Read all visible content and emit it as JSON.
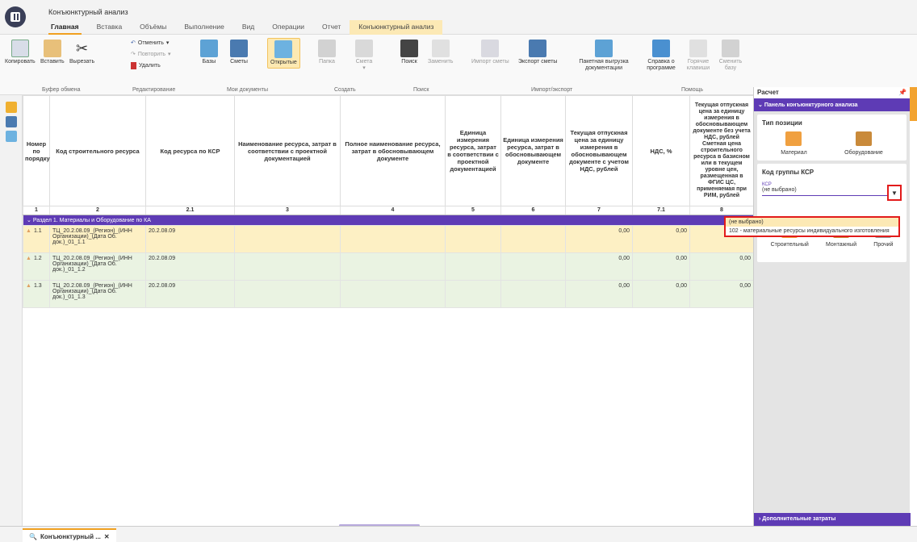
{
  "app": {
    "title": "Конъюнктурный анализ"
  },
  "tabs": [
    "Главная",
    "Вставка",
    "Объёмы",
    "Выполнение",
    "Вид",
    "Операции",
    "Отчет",
    "Конъюнктурный анализ"
  ],
  "ribbon": {
    "copy": "Копировать",
    "paste": "Вставить",
    "cut": "Вырезать",
    "clipboard_group": "Буфер обмена",
    "undo": "Отменить",
    "redo": "Повторить",
    "delete": "Удалить",
    "edit_group": "Редактирование",
    "bases": "Базы",
    "estimates": "Сметы",
    "opened": "Открытые",
    "mydocs_group": "Мои документы",
    "folder": "Папка",
    "estimate": "Смета",
    "create_group": "Создать",
    "search": "Поиск",
    "replace": "Заменить",
    "search_group": "Поиск",
    "import": "Импорт сметы",
    "export": "Экспорт сметы",
    "batch": "Пакетная выгрузка документации",
    "io_group": "Импорт/экспорт",
    "about": "Справка о программе",
    "hotkeys": "Горячие клавиши",
    "changebase": "Сменить базу",
    "help_group": "Помощь"
  },
  "grid": {
    "headers": [
      "Номер по порядку",
      "Код строительного ресурса",
      "Код ресурса по КСР",
      "Наименование ресурса, затрат в соответствии с проектной документацией",
      "Полное наименование ресурса, затрат в обосновывающем документе",
      "Единица измерения ресурса, затрат в соответствии с проектной документацией",
      "Единица измерения ресурса, затрат в обосновывающем документе",
      "Текущая отпускная цена за единицу измерения в обосновывающем документе с учетом НДС, рублей",
      "НДС, %",
      "Текущая отпускная цена за единицу измерения в обосновывающем документе без учета НДС, рублей Сметная цена строительного ресурса в базисном или в текущем уровне цен, размещенная в ФГИС ЦС, применяемая при РИМ, рублей"
    ],
    "numbers": [
      "1",
      "2",
      "2.1",
      "3",
      "4",
      "5",
      "6",
      "7",
      "7.1",
      "8"
    ],
    "section": "Раздел 1. Материалы и Оборудование по КА",
    "rows": [
      {
        "n": "1.1",
        "code": "ТЦ_20.2.08.09_(Регион)_(ИНН Организации)_(Дата Об. док.)_01_1.1",
        "ksr": "20.2.08.09",
        "price": "0,00",
        "vat": "0,00",
        "p8": ""
      },
      {
        "n": "1.2",
        "code": "ТЦ_20.2.08.09_(Регион)_(ИНН Организации)_(Дата Об. док.)_01_1.2",
        "ksr": "20.2.08.09",
        "price": "0,00",
        "vat": "0,00",
        "p8": "0,00"
      },
      {
        "n": "1.3",
        "code": "ТЦ_20.2.08.09_(Регион)_(ИНН Организации)_(Дата Об. док.)_01_1.3",
        "ksr": "20.2.08.09",
        "price": "0,00",
        "vat": "0,00",
        "p8": "0,00"
      }
    ]
  },
  "panel": {
    "title": "Расчет",
    "header": "Панель конъюнктурного анализа",
    "type_title": "Тип позиции",
    "material": "Материал",
    "equipment": "Оборудование",
    "ksr_title": "Код группы КСР",
    "ksr_label": "КСР",
    "ksr_value": "(не выбрано)",
    "opt_build": "Строительный",
    "opt_mount": "Монтажный",
    "opt_other": "Прочий",
    "footer": "Дополнительные затраты"
  },
  "dropdown": [
    "(не выбрано)",
    "102 - материальные ресурсы индивидуального изготовления"
  ],
  "doc_tab": "Конъюнктурный ..."
}
